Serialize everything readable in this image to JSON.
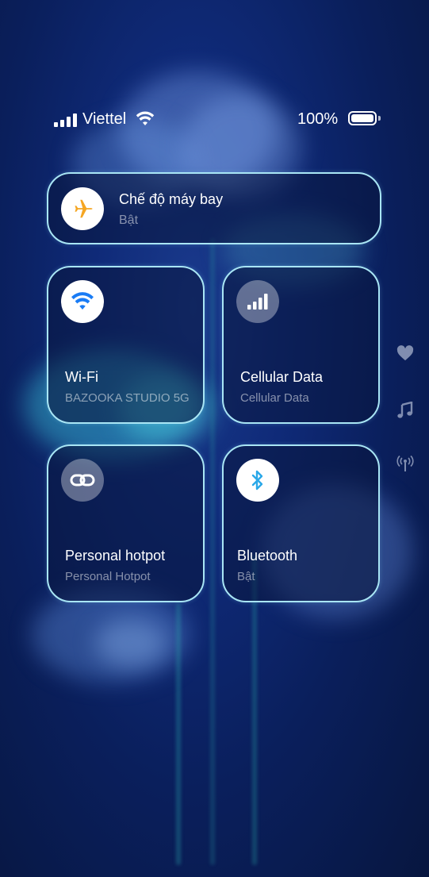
{
  "status_bar": {
    "carrier": "Viettel",
    "battery_percent": "100%",
    "signal_bars": 4,
    "battery_level": 1.0
  },
  "airplane_mode": {
    "title": "Chế độ máy bay",
    "state": "Bật",
    "icon": "airplane-icon",
    "accent": "#f5a623"
  },
  "tiles": [
    {
      "id": "wifi",
      "title": "Wi-Fi",
      "subtitle": "BAZOOKA STUDIO 5G",
      "icon": "wifi-icon",
      "active": true,
      "accent": "#1a7cf5"
    },
    {
      "id": "cellular",
      "title": "Cellular Data",
      "subtitle": "Cellular Data",
      "icon": "cellular-bars-icon",
      "active": false
    },
    {
      "id": "hotspot",
      "title": "Personal hotpot",
      "subtitle": "Personal Hotpot",
      "icon": "link-icon",
      "active": false
    },
    {
      "id": "bluetooth",
      "title": "Bluetooth",
      "subtitle": "Bật",
      "icon": "bluetooth-icon",
      "active": true,
      "accent": "#2aa8e8"
    }
  ],
  "side_icons": [
    "heart-icon",
    "music-note-icon",
    "broadcast-icon"
  ],
  "colors": {
    "card_border": "#a9e6f5",
    "background": "#0f2a78"
  }
}
